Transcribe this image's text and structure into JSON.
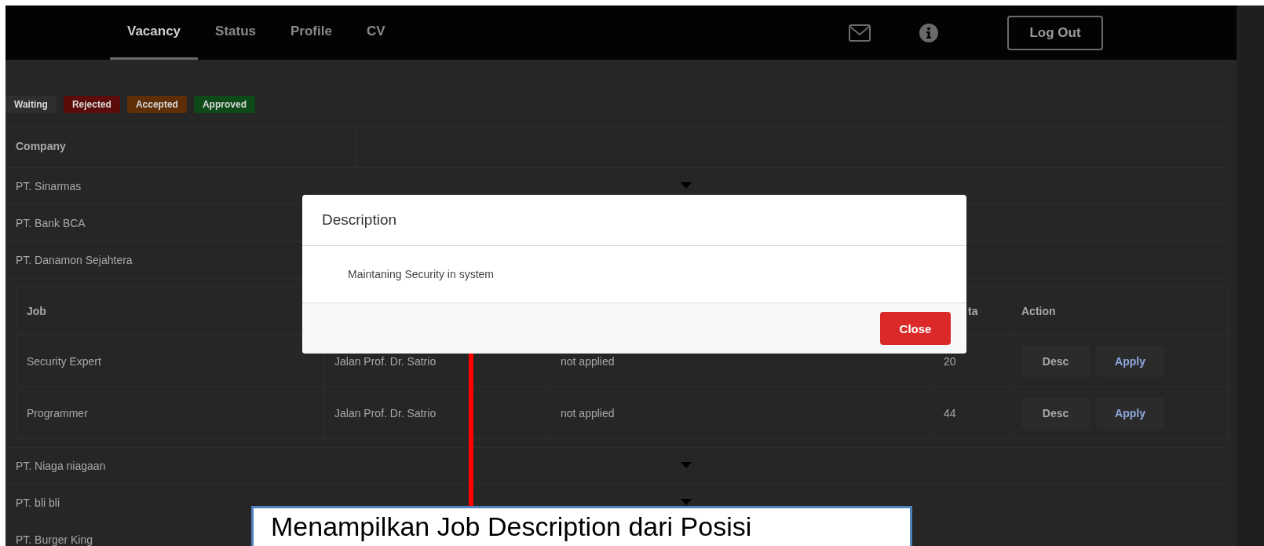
{
  "nav": {
    "tabs": [
      {
        "label": "Vacancy",
        "selected": true
      },
      {
        "label": "Status",
        "selected": false
      },
      {
        "label": "Profile",
        "selected": false
      },
      {
        "label": "CV",
        "selected": false
      }
    ],
    "logout": "Log Out"
  },
  "legend": [
    {
      "label": "Waiting",
      "color": "#2e2e2e"
    },
    {
      "label": "Rejected",
      "color": "#5c0b0b"
    },
    {
      "label": "Accepted",
      "color": "#5e2e06"
    },
    {
      "label": "Approved",
      "color": "#0d4a17"
    }
  ],
  "companies": {
    "header": "Company",
    "rows": [
      {
        "name": "PT. Sinarmas",
        "expanded": false
      },
      {
        "name": "PT. Bank BCA",
        "expanded": false
      },
      {
        "name": "PT. Danamon Sejahtera",
        "expanded": true,
        "jobs": {
          "columns": [
            {
              "label": "Job"
            },
            {},
            {},
            {
              "label": "ta"
            },
            {
              "label": "Action"
            }
          ],
          "rows": [
            {
              "cells": [
                "Security Expert",
                "Jalan Prof. Dr. Satrio",
                "not applied",
                "20"
              ],
              "actions": [
                "Desc",
                "Apply"
              ]
            },
            {
              "cells": [
                "Programmer",
                "Jalan Prof. Dr. Satrio",
                "not applied",
                "44"
              ],
              "actions": [
                "Desc",
                "Apply"
              ]
            }
          ]
        }
      },
      {
        "name": "PT. Niaga niagaan",
        "expanded": false
      },
      {
        "name": "PT. bli bli",
        "expanded": false
      },
      {
        "name": "PT. Burger King",
        "expanded": false
      }
    ]
  },
  "modal": {
    "title": "Description",
    "body": "Maintaning Security in system",
    "close": "Close"
  },
  "callout": {
    "text": "Menampilkan Job Description dari Posisi"
  }
}
